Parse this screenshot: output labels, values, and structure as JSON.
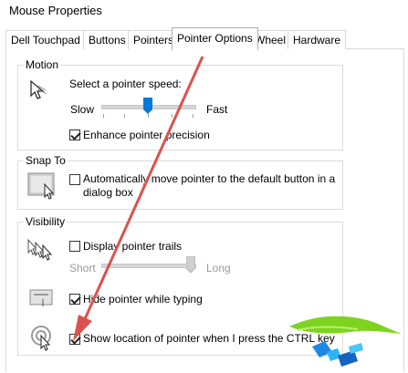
{
  "window": {
    "title": "Mouse Properties"
  },
  "tabs": [
    {
      "label": "Dell Touchpad"
    },
    {
      "label": "Buttons"
    },
    {
      "label": "Pointers"
    },
    {
      "label": "Pointer Options"
    },
    {
      "label": "Wheel"
    },
    {
      "label": "Hardware"
    }
  ],
  "active_tab": "Pointer Options",
  "motion": {
    "group_label": "Motion",
    "speed_label": "Select a pointer speed:",
    "slow_label": "Slow",
    "fast_label": "Fast",
    "speed_level": 0.5,
    "enhance_label": "Enhance pointer precision",
    "enhance_checked": true
  },
  "snap_to": {
    "group_label": "Snap To",
    "auto_move_label_line1": "Automatically move pointer to the default button in a",
    "auto_move_label_line2": "dialog box",
    "auto_move_checked": false
  },
  "visibility": {
    "group_label": "Visibility",
    "trails_label": "Display pointer trails",
    "trails_checked": false,
    "short_label": "Short",
    "long_label": "Long",
    "trail_level": 1.0,
    "hide_label": "Hide pointer while typing",
    "hide_checked": true,
    "ctrl_label": "Show location of pointer when I press the CTRL key",
    "ctrl_checked": true
  },
  "colors": {
    "slider_thumb": "#0078d7",
    "annotation_arrow": "#d9534f",
    "watermark_green": "#7ed321",
    "watermark_blue": "#1e88e5"
  },
  "icons": [
    "pointer-speed-icon",
    "snap-to-icon",
    "pointer-trails-icon",
    "hide-pointer-icon",
    "show-location-icon"
  ]
}
